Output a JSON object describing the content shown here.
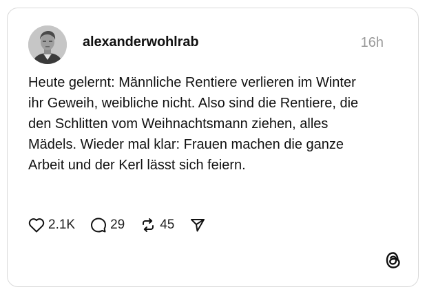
{
  "post": {
    "username": "alexanderwohlrab",
    "time": "16h",
    "text": "Heute gelernt: Männliche Rentiere verlieren im Winter ihr Geweih, weibliche nicht. Also sind die Rentiere, die den Schlitten vom Weihnachtsmann ziehen, alles Mädels. Wieder mal klar: Frauen machen die ganze Arbeit und der Kerl lässt sich feiern."
  },
  "actions": {
    "likes": "2.1K",
    "replies": "29",
    "reposts": "45"
  },
  "icons": {
    "like": "heart-icon",
    "reply": "comment-bubble-icon",
    "repost": "repost-arrows-icon",
    "share": "send-icon",
    "brand": "threads-logo-icon"
  },
  "colors": {
    "text": "#111111",
    "muted": "#9a9a9a",
    "border": "#d9d9d9"
  }
}
